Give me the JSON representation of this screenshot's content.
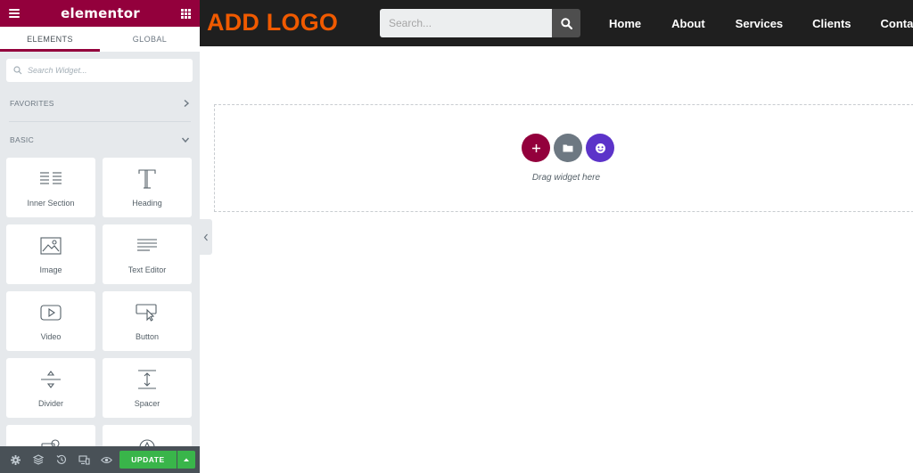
{
  "panel": {
    "brand": "elementor",
    "tabs": [
      {
        "label": "ELEMENTS"
      },
      {
        "label": "GLOBAL"
      }
    ],
    "search_placeholder": "Search Widget...",
    "categories": {
      "favorites": "FAVORITES",
      "basic": "BASIC"
    },
    "widgets": [
      {
        "label": "Inner Section",
        "icon": "inner-section-icon"
      },
      {
        "label": "Heading",
        "icon": "heading-icon"
      },
      {
        "label": "Image",
        "icon": "image-icon"
      },
      {
        "label": "Text Editor",
        "icon": "text-editor-icon"
      },
      {
        "label": "Video",
        "icon": "video-icon"
      },
      {
        "label": "Button",
        "icon": "button-icon"
      },
      {
        "label": "Divider",
        "icon": "divider-icon"
      },
      {
        "label": "Spacer",
        "icon": "spacer-icon"
      }
    ],
    "footer": {
      "update_label": "UPDATE"
    }
  },
  "site": {
    "logo": "ADD LOGO",
    "search_placeholder": "Search...",
    "nav": [
      "Home",
      "About",
      "Services",
      "Clients",
      "Contact"
    ]
  },
  "canvas": {
    "drop_text": "Drag widget here"
  },
  "colors": {
    "brand": "#93003c",
    "logo": "#f05a00",
    "update": "#39b54a",
    "template_library": "#6d7882",
    "starter": "#5c33c9"
  }
}
